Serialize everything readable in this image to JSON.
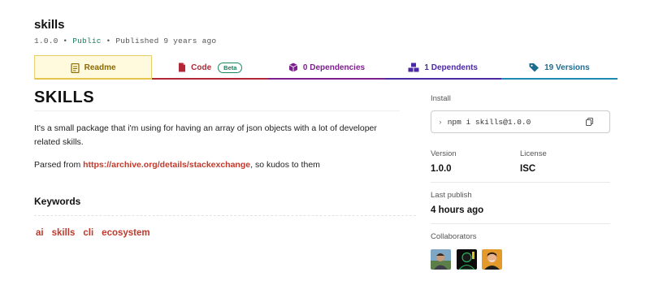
{
  "package": {
    "name": "skills",
    "version": "1.0.0",
    "visibility": "Public",
    "published": "Published 9 years ago",
    "separator": "•"
  },
  "tabs": [
    {
      "label": "Readme",
      "icon": "readme-icon"
    },
    {
      "label": "Code",
      "icon": "code-icon",
      "badge": "Beta"
    },
    {
      "label": "0 Dependencies",
      "icon": "dependencies-icon"
    },
    {
      "label": "1 Dependents",
      "icon": "dependents-icon"
    },
    {
      "label": "19 Versions",
      "icon": "versions-icon"
    }
  ],
  "readme": {
    "title": "SKILLS",
    "description": "It's a small package that i'm using for having an array of json objects with a lot of developer related skills.",
    "parsed_prefix": "Parsed from ",
    "parsed_link": "https://archive.org/details/stackexchange",
    "parsed_suffix": ", so kudos to them",
    "keywords_heading": "Keywords",
    "keywords": [
      "ai",
      "skills",
      "cli",
      "ecosystem"
    ]
  },
  "sidebar": {
    "install_label": "Install",
    "install_command": "npm i skills@1.0.0",
    "version_label": "Version",
    "version_value": "1.0.0",
    "license_label": "License",
    "license_value": "ISC",
    "last_publish_label": "Last publish",
    "last_publish_value": "4 hours ago",
    "collaborators_label": "Collaborators"
  },
  "colors": {
    "readme": "#8a6a00",
    "code": "#b32635",
    "dependencies": "#7b1f8c",
    "dependents": "#4b2aa3",
    "versions": "#1d6b8e",
    "link": "#c0392b",
    "public": "#1a7d5a"
  }
}
